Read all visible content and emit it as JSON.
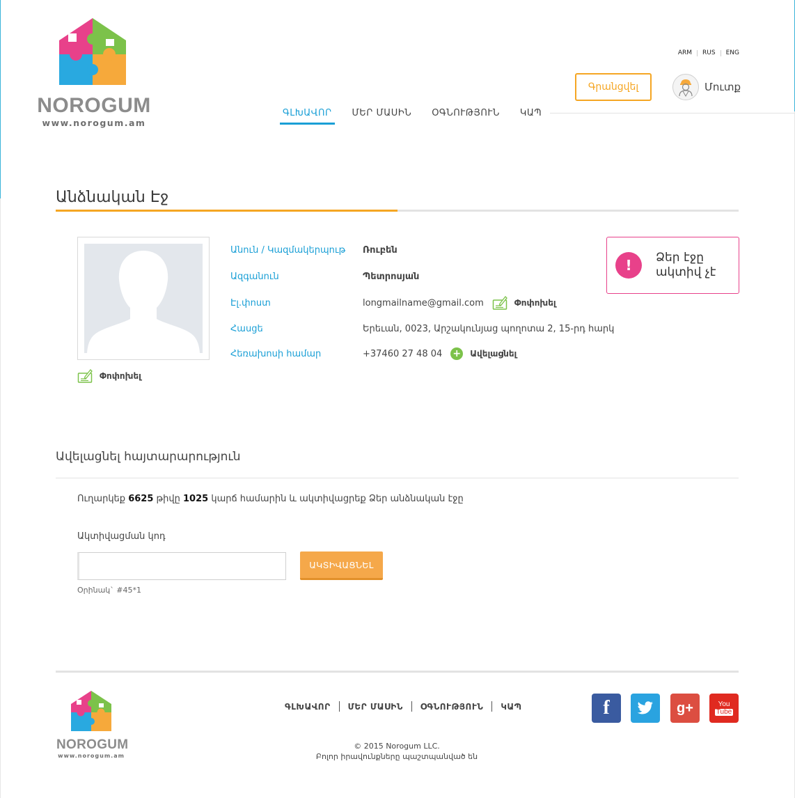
{
  "header": {
    "logo": {
      "name": "NOROGUM",
      "url": "www.norogum.am"
    },
    "languages": [
      "ARM",
      "RUS",
      "ENG"
    ],
    "register_label": "Գրանցվել",
    "login_label": "Մուտք",
    "nav": [
      {
        "label": "ԳԼԽԱՎՈՐ",
        "active": true
      },
      {
        "label": "ՄԵՐ ՄԱՍԻՆ",
        "active": false
      },
      {
        "label": "ՕԳՆՈՒԹՅՈՒՆ",
        "active": false
      },
      {
        "label": "ԿԱՊ",
        "active": false
      }
    ]
  },
  "page_title": "Անձնական Էջ",
  "profile": {
    "photo_edit_label": "Փոփոխել",
    "fields": [
      {
        "label": "Անուն / Կազմակերպութ",
        "value": "Ռուբեն"
      },
      {
        "label": "Ազգանուն",
        "value": "Պետրոսյան"
      },
      {
        "label": "Էլ.փոստ",
        "value": "longmailname@gmail.com",
        "action": "Փոփոխել"
      },
      {
        "label": "Հասցե",
        "value": "Երեւան, 0023, Արշակունյաց պողոտա 2, 15-րդ հարկ"
      },
      {
        "label": "Հեռախոսի համար",
        "value": "+37460 27 48 04",
        "action": "Ավելացնել"
      }
    ]
  },
  "alert": {
    "icon": "!",
    "text": "Ձեր էջը ակտիվ չէ"
  },
  "activation": {
    "title": "Ավելացնել հայտարարություն",
    "sms_prefix": "Ուղարկեք",
    "sms_code": "6625",
    "sms_mid": "թիվը",
    "sms_number": "1025",
    "sms_suffix": "կարճ համարին և ակտիվացրեք Ձեր անձնական էջը",
    "code_label": "Ակտիվացման կոդ",
    "code_value": "",
    "button_label": "ԱԿՏԻՎԱՑՆԵԼ",
    "example": "Օրինակ` #45*1"
  },
  "footer": {
    "logo": {
      "name": "NOROGUM",
      "url": "www.norogum.am"
    },
    "nav": [
      "ԳԼԽԱՎՈՐ",
      "ՄԵՐ ՄԱՍԻՆ",
      "ՕԳՆՈՒԹՅՈՒՆ",
      "ԿԱՊ"
    ],
    "copyright_line1": "© 2015 Norogum LLC.",
    "copyright_line2": "Բոլոր իրավունքները պաշտպանված են",
    "social": [
      {
        "name": "facebook-icon",
        "glyph": "f",
        "color": "#3a5ba0"
      },
      {
        "name": "twitter-icon",
        "color": "#2aa3e0"
      },
      {
        "name": "google-plus-icon",
        "glyph": "g+",
        "color": "#dc4e41"
      },
      {
        "name": "youtube-icon",
        "glyph_top": "You",
        "glyph_bottom": "Tube",
        "color": "#e02a20"
      }
    ]
  },
  "colors": {
    "accent_blue": "#1a9fd6",
    "accent_orange": "#f5a623",
    "alert_pink": "#e8418a",
    "green": "#7cc24a"
  }
}
